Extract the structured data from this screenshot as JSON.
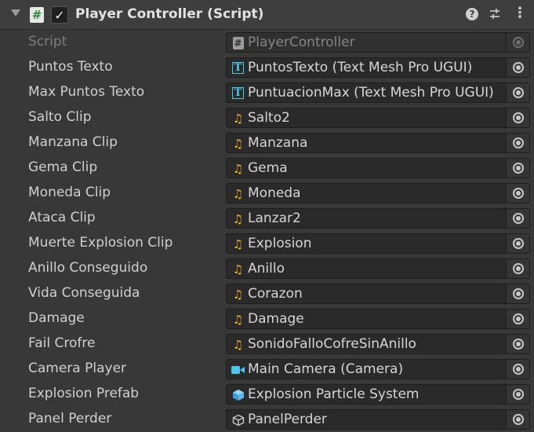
{
  "component": {
    "title": "Player Controller (Script)",
    "enabled_checkmark": "✓",
    "script_icon_glyph": "#",
    "help_glyph": "?",
    "menu_glyph": "⋮"
  },
  "colors": {
    "background": "#383838",
    "field_background": "#2a2a2a",
    "audio_icon": "#f3b817",
    "tmp_icon": "#4ac8f0",
    "camera_icon": "#4ac8f0",
    "prefab_icon": "#5ab8f0"
  },
  "fields": [
    {
      "label": "Script",
      "value": "PlayerController",
      "icon": "cs-script-icon",
      "disabled": true
    },
    {
      "label": "Puntos Texto",
      "value": "PuntosTexto (Text Mesh Pro UGUI)",
      "icon": "text-mesh-pro-icon"
    },
    {
      "label": "Max Puntos Texto",
      "value": "PuntuacionMax (Text Mesh Pro UGUI)",
      "icon": "text-mesh-pro-icon"
    },
    {
      "label": "Salto Clip",
      "value": "Salto2",
      "icon": "audio-clip-icon"
    },
    {
      "label": "Manzana Clip",
      "value": "Manzana",
      "icon": "audio-clip-icon"
    },
    {
      "label": "Gema Clip",
      "value": "Gema",
      "icon": "audio-clip-icon"
    },
    {
      "label": "Moneda Clip",
      "value": "Moneda",
      "icon": "audio-clip-icon"
    },
    {
      "label": "Ataca Clip",
      "value": "Lanzar2",
      "icon": "audio-clip-icon"
    },
    {
      "label": "Muerte Explosion Clip",
      "value": "Explosion",
      "icon": "audio-clip-icon"
    },
    {
      "label": "Anillo Conseguido",
      "value": "Anillo",
      "icon": "audio-clip-icon"
    },
    {
      "label": "Vida Conseguida",
      "value": "Corazon",
      "icon": "audio-clip-icon"
    },
    {
      "label": "Damage",
      "value": "Damage",
      "icon": "audio-clip-icon"
    },
    {
      "label": "Fail Crofre",
      "value": "SonidoFalloCofreSinAnillo",
      "icon": "audio-clip-icon"
    },
    {
      "label": "Camera Player",
      "value": "Main Camera (Camera)",
      "icon": "camera-icon"
    },
    {
      "label": "Explosion Prefab",
      "value": "Explosion Particle System",
      "icon": "prefab-icon"
    },
    {
      "label": "Panel Perder",
      "value": "PanelPerder",
      "icon": "game-object-icon"
    }
  ]
}
